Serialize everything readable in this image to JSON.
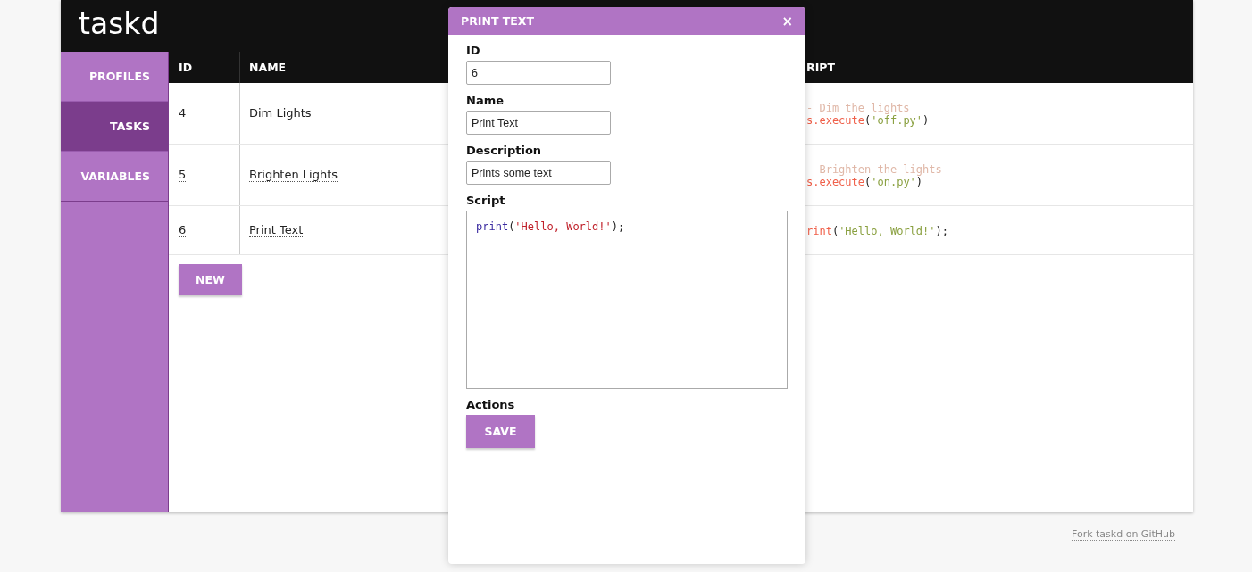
{
  "app": {
    "logo": "taskd"
  },
  "sidebar": {
    "items": [
      {
        "label": "PROFILES",
        "selected": false
      },
      {
        "label": "TASKS",
        "selected": true
      },
      {
        "label": "VARIABLES",
        "selected": false
      }
    ]
  },
  "table": {
    "columns": [
      "ID",
      "NAME",
      "RIPT"
    ],
    "rows": [
      {
        "id": "4",
        "name": "Dim Lights",
        "script": [
          [
            {
              "kind": "comment",
              "text": "- Dim the lights"
            }
          ],
          [
            {
              "kind": "call",
              "text": "s.execute"
            },
            {
              "kind": "punct",
              "text": "("
            },
            {
              "kind": "string",
              "text": "'off.py'"
            },
            {
              "kind": "punct",
              "text": ")"
            }
          ]
        ]
      },
      {
        "id": "5",
        "name": "Brighten Lights",
        "script": [
          [
            {
              "kind": "comment",
              "text": "- Brighten the lights"
            }
          ],
          [
            {
              "kind": "call",
              "text": "s.execute"
            },
            {
              "kind": "punct",
              "text": "("
            },
            {
              "kind": "string",
              "text": "'on.py'"
            },
            {
              "kind": "punct",
              "text": ")"
            }
          ]
        ]
      },
      {
        "id": "6",
        "name": "Print Text",
        "script": [
          [
            {
              "kind": "call",
              "text": "rint"
            },
            {
              "kind": "punct",
              "text": "("
            },
            {
              "kind": "string",
              "text": "'Hello, World!'"
            },
            {
              "kind": "punct",
              "text": ");"
            }
          ]
        ]
      }
    ],
    "new_button": "NEW"
  },
  "dialog": {
    "title": "PRINT TEXT",
    "close": "×",
    "fields": [
      {
        "label": "ID",
        "kind": "input",
        "value": "6"
      },
      {
        "label": "Name",
        "kind": "input",
        "value": "Print Text"
      },
      {
        "label": "Description",
        "kind": "input",
        "value": "Prints some text"
      },
      {
        "label": "Script",
        "kind": "code",
        "lines": [
          [
            {
              "kind": "call",
              "text": "print"
            },
            {
              "kind": "punct",
              "text": "("
            },
            {
              "kind": "string",
              "text": "'Hello, World!'"
            },
            {
              "kind": "punct",
              "text": ");"
            }
          ]
        ]
      }
    ],
    "actions_label": "Actions",
    "save_button": "SAVE"
  },
  "footer": {
    "link": "Fork taskd on GitHub"
  }
}
